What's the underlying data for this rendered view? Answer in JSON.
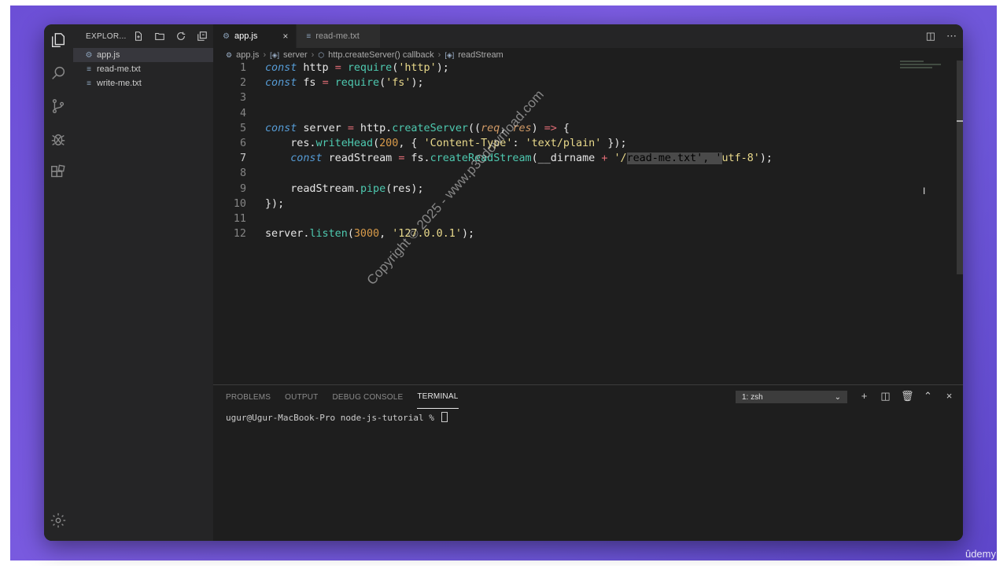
{
  "sidebar": {
    "title": "EXPLOR...",
    "files": [
      {
        "name": "app.js",
        "icon": "gear-file",
        "active": true
      },
      {
        "name": "read-me.txt",
        "icon": "text-file"
      },
      {
        "name": "write-me.txt",
        "icon": "text-file"
      }
    ]
  },
  "tabs": [
    {
      "label": "app.js",
      "active": true,
      "close": "×"
    },
    {
      "label": "read-me.txt",
      "active": false
    }
  ],
  "breadcrumb": [
    "app.js",
    "server",
    "http.createServer() callback",
    "readStream"
  ],
  "code": {
    "line_numbers": [
      "1",
      "2",
      "3",
      "4",
      "5",
      "6",
      "7",
      "8",
      "9",
      "10",
      "11",
      "12"
    ],
    "lines": [
      [
        [
          "kw",
          "const"
        ],
        [
          "var",
          " http "
        ],
        [
          "op",
          "="
        ],
        [
          "var",
          " "
        ],
        [
          "fn",
          "require"
        ],
        [
          "punc",
          "("
        ],
        [
          "str",
          "'http'"
        ],
        [
          "punc",
          ");"
        ]
      ],
      [
        [
          "kw",
          "const"
        ],
        [
          "var",
          " fs "
        ],
        [
          "op",
          "="
        ],
        [
          "var",
          " "
        ],
        [
          "fn",
          "require"
        ],
        [
          "punc",
          "("
        ],
        [
          "str",
          "'fs'"
        ],
        [
          "punc",
          ");"
        ]
      ],
      [],
      [],
      [
        [
          "kw",
          "const"
        ],
        [
          "var",
          " server "
        ],
        [
          "op",
          "="
        ],
        [
          "var",
          " http."
        ],
        [
          "fn",
          "createServer"
        ],
        [
          "punc",
          "(("
        ],
        [
          "param",
          "req"
        ],
        [
          "punc",
          ", "
        ],
        [
          "param",
          "res"
        ],
        [
          "punc",
          ") "
        ],
        [
          "op",
          "=>"
        ],
        [
          "punc",
          " {"
        ]
      ],
      [
        [
          "var",
          "    res."
        ],
        [
          "fn",
          "writeHead"
        ],
        [
          "punc",
          "("
        ],
        [
          "num",
          "200"
        ],
        [
          "punc",
          ", { "
        ],
        [
          "str",
          "'Content-Type'"
        ],
        [
          "punc",
          ": "
        ],
        [
          "str",
          "'text/plain'"
        ],
        [
          "punc",
          " });"
        ]
      ],
      [
        [
          "kw",
          "    const"
        ],
        [
          "var",
          " readStream "
        ],
        [
          "op",
          "="
        ],
        [
          "var",
          " fs."
        ],
        [
          "fn",
          "createReadStream"
        ],
        [
          "punc",
          "(__dirname "
        ],
        [
          "op",
          "+"
        ],
        [
          "punc",
          " "
        ],
        [
          "str",
          "'/"
        ],
        [
          "sel",
          "read-me.txt', '"
        ],
        [
          "str",
          "utf-8'"
        ],
        [
          "punc",
          ");"
        ]
      ],
      [],
      [
        [
          "var",
          "    readStream."
        ],
        [
          "fn",
          "pipe"
        ],
        [
          "punc",
          "(res);"
        ]
      ],
      [
        [
          "punc",
          "});"
        ]
      ],
      [],
      [
        [
          "var",
          "server."
        ],
        [
          "fn",
          "listen"
        ],
        [
          "punc",
          "("
        ],
        [
          "num",
          "3000"
        ],
        [
          "punc",
          ", "
        ],
        [
          "str",
          "'127.0.0.1'"
        ],
        [
          "punc",
          ");"
        ]
      ]
    ]
  },
  "panel": {
    "tabs": [
      "PROBLEMS",
      "OUTPUT",
      "DEBUG CONSOLE",
      "TERMINAL"
    ],
    "active_tab": "TERMINAL",
    "shell": "1: zsh",
    "terminal_line": "ugur@Ugur-MacBook-Pro node-js-tutorial % "
  },
  "watermark": "Copyright © 2025 - www.p30download.com",
  "brand": "ûdemy",
  "colors": {
    "keyword": "#569cd6",
    "function": "#4ec9b0",
    "string": "#e9d98b",
    "number": "#d99b4a",
    "operator": "#e06c75"
  }
}
